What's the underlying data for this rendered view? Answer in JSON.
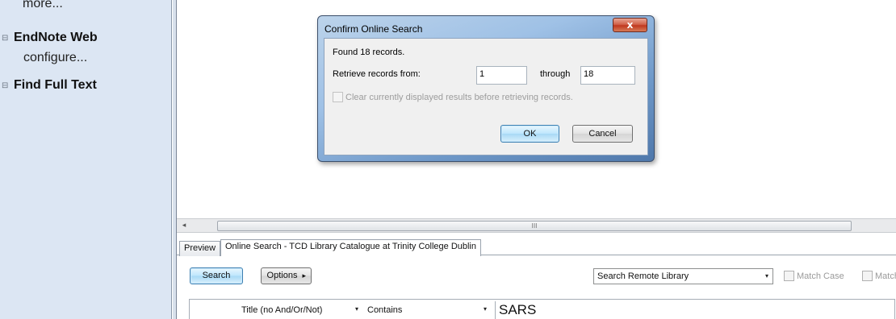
{
  "sidebar": {
    "more_link": "more...",
    "endnote_web": {
      "expander": "⊟",
      "label": "EndNote Web",
      "configure": "configure..."
    },
    "find_full_text": {
      "expander": "⊟",
      "label": "Find Full Text"
    }
  },
  "scrollbar": {
    "left_arrow": "◂",
    "grip": "III"
  },
  "bottom_panel": {
    "tabs": [
      {
        "label": "Preview"
      },
      {
        "label": "Online Search - TCD Library Catalogue at Trinity College Dublin"
      }
    ],
    "search_button": "Search",
    "options_button": "Options",
    "options_arrow": "▸",
    "mode_select": "Search Remote Library",
    "match_case": "Match Case",
    "match_words": "Match",
    "row": {
      "field": "Title (no And/Or/Not)",
      "operator": "Contains",
      "term": "SARS"
    }
  },
  "dialog": {
    "title": "Confirm Online Search",
    "close": "x",
    "found_text": "Found 18 records.",
    "retrieve_label": "Retrieve records from:",
    "from_value": "1",
    "through_label": "through",
    "to_value": "18",
    "clear_label": "Clear currently displayed results before retrieving records.",
    "ok_button": "OK",
    "cancel_button": "Cancel"
  },
  "icons": {
    "dropdown": "▾"
  }
}
